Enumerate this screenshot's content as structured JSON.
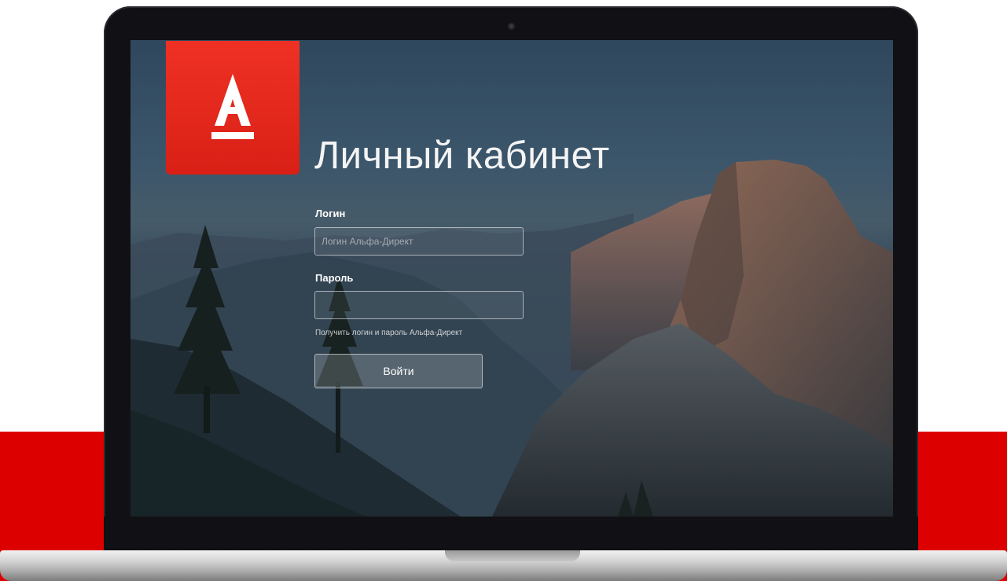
{
  "brand": {
    "name": "Альфа-Банк",
    "logo_letter": "A",
    "color": "#ef3124"
  },
  "page": {
    "title": "Личный кабинет",
    "accent_background": "#dd0000"
  },
  "form": {
    "login": {
      "label": "Логин",
      "value": "",
      "placeholder": "Логин Альфа-Директ"
    },
    "password": {
      "label": "Пароль",
      "value": "",
      "placeholder": ""
    },
    "help_link": "Получить логин и пароль Альфа-Директ",
    "submit_label": "Войти"
  },
  "icons": {
    "logo": "alfa-bank-logo-icon",
    "camera": "webcam-icon"
  }
}
